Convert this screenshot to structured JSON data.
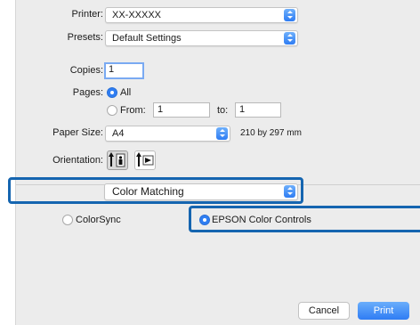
{
  "printer": {
    "label": "Printer:",
    "value": "XX-XXXXX"
  },
  "presets": {
    "label": "Presets:",
    "value": "Default Settings"
  },
  "copies": {
    "label": "Copies:",
    "value": "1"
  },
  "pages": {
    "label": "Pages:",
    "all_label": "All",
    "from_label": "From:",
    "from_value": "1",
    "to_label": "to:",
    "to_value": "1"
  },
  "paper_size": {
    "label": "Paper Size:",
    "value": "A4",
    "dimensions": "210 by 297 mm"
  },
  "orientation": {
    "label": "Orientation:"
  },
  "section_popup": {
    "value": "Color Matching"
  },
  "color_options": {
    "colorsync_label": "ColorSync",
    "epson_label": "EPSON Color Controls"
  },
  "buttons": {
    "cancel": "Cancel",
    "print": "Print"
  },
  "colors": {
    "accent": "#2f7ef3",
    "highlight_frame": "#1565b0"
  }
}
